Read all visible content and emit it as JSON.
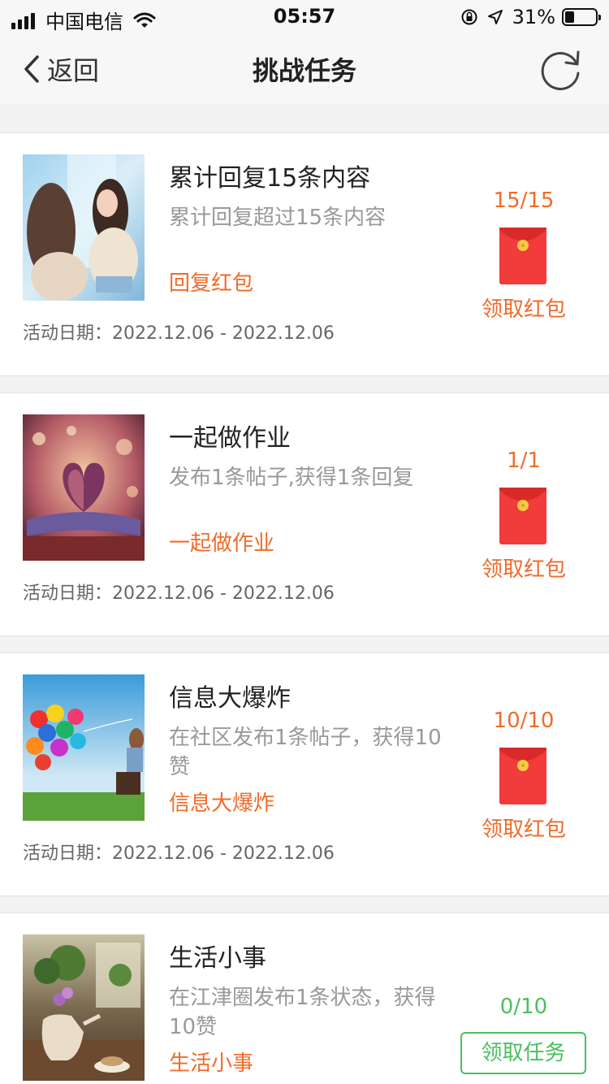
{
  "status_bar": {
    "carrier": "中国电信",
    "time": "05:57",
    "battery_percent": "31%"
  },
  "nav": {
    "back_label": "返回",
    "title": "挑战任务"
  },
  "tasks": [
    {
      "title": "累计回复15条内容",
      "description": "累计回复超过15条内容",
      "tag": "回复红包",
      "date": "活动日期：2022.12.06 - 2022.12.06",
      "progress": "15/15",
      "action_label": "领取红包",
      "action_type": "claim-red-packet"
    },
    {
      "title": "一起做作业",
      "description": "发布1条帖子,获得1条回复",
      "tag": "一起做作业",
      "date": "活动日期：2022.12.06 - 2022.12.06",
      "progress": "1/1",
      "action_label": "领取红包",
      "action_type": "claim-red-packet"
    },
    {
      "title": "信息大爆炸",
      "description": "在社区发布1条帖子，获得10赞",
      "tag": "信息大爆炸",
      "date": "活动日期：2022.12.06 - 2022.12.06",
      "progress": "10/10",
      "action_label": "领取红包",
      "action_type": "claim-red-packet"
    },
    {
      "title": "生活小事",
      "description": "在江津圈发布1条状态，获得10赞",
      "tag": "生活小事",
      "date": "",
      "progress": "0/10",
      "action_label": "领取任务",
      "action_type": "accept-task"
    }
  ],
  "colors": {
    "accent_orange": "#f06b2a",
    "accent_green": "#4bbf5f",
    "red_packet": "#f23b3b"
  }
}
